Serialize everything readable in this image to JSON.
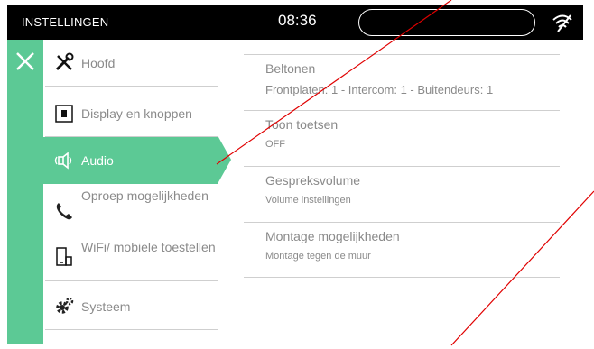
{
  "header": {
    "title": "INSTELLINGEN",
    "time": "08:36"
  },
  "icons": {
    "close": "close-icon",
    "wifi": "wifi-icon"
  },
  "menu": [
    {
      "label": "Hoofd",
      "icon": "wrench-screwdriver-icon"
    },
    {
      "label": "Display en knoppen",
      "icon": "display-icon"
    },
    {
      "label": "Audio",
      "icon": "speaker-icon",
      "active": true
    },
    {
      "label": "Oproep mogelijkheden",
      "icon": "phone-icon"
    },
    {
      "label": "WiFi/ mobiele toestellen",
      "icon": "mobile-device-icon"
    },
    {
      "label": "Systeem",
      "icon": "gears-icon"
    }
  ],
  "settings": [
    {
      "title": "Beltonen",
      "subtitle": "Frontplaten: 1 - Intercom: 1 - Buitendeurs: 1"
    },
    {
      "title": "Toon toetsen",
      "subtitle": "OFF"
    },
    {
      "title": "Gespreksvolume",
      "subtitle": "Volume instellingen"
    },
    {
      "title": "Montage mogelijkheden",
      "subtitle": "Montage tegen de muur"
    }
  ],
  "colors": {
    "accent": "#5cc995",
    "text": "#8a8a8a",
    "divider": "#cfcfcf",
    "bezel": "#000000",
    "annotation": "#e00000"
  }
}
